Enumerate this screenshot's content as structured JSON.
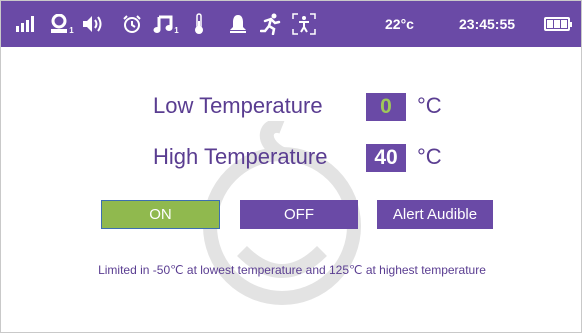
{
  "status_bar": {
    "icons": [
      "signal-icon",
      "person-icon",
      "speaker-icon",
      "alarm-icon",
      "music-icon",
      "thermometer-icon",
      "bell-icon",
      "running-icon",
      "motion-frame-icon"
    ],
    "person_sub": "1",
    "music_sub": "1",
    "temperature": "22°c",
    "clock": "23:45:55",
    "battery_level": 1.0,
    "background_color": "#6a4aa6"
  },
  "low": {
    "label": "Low Temperature",
    "value": "0",
    "unit": "°C",
    "value_color": "#9fc85a"
  },
  "high": {
    "label": "High Temperature",
    "value": "40",
    "unit": "°C",
    "value_color": "#ffffff"
  },
  "buttons": {
    "on": "ON",
    "off": "OFF",
    "alert": "Alert Audible",
    "on_color": "#90b94e",
    "accent_color": "#6a4aa6"
  },
  "note": "Limited in -50℃ at lowest temperature and 125℃ at highest temperature"
}
